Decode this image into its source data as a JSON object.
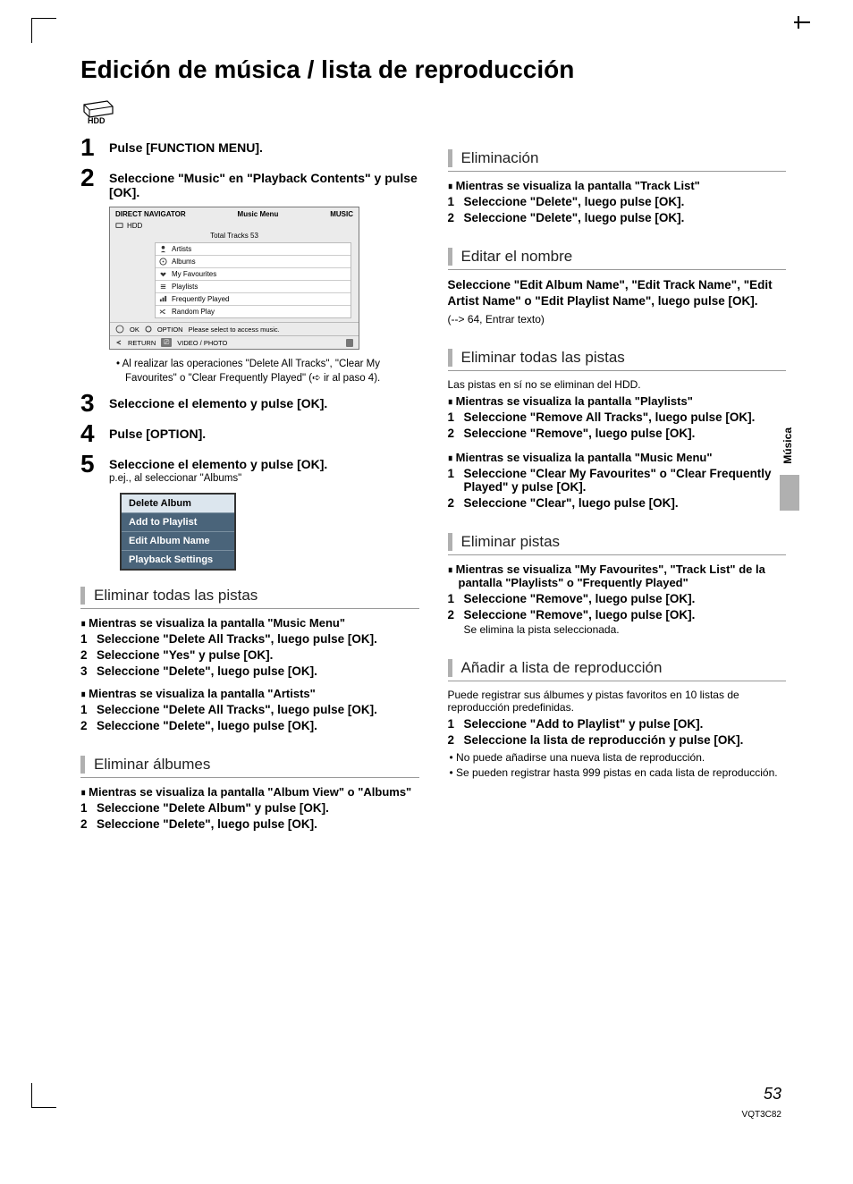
{
  "page_title": "Edición de música / lista de reproducción",
  "hdd_label": "HDD",
  "steps": {
    "s1": "Pulse [FUNCTION MENU].",
    "s2": "Seleccione \"Music\" en \"Playback Contents\" y pulse [OK].",
    "s3": "Seleccione el elemento y pulse [OK].",
    "s4": "Pulse [OPTION].",
    "s5": "Seleccione el elemento y pulse [OK].",
    "s5_sub": "p.ej., al seleccionar \"Albums\""
  },
  "ui": {
    "header_left": "DIRECT NAVIGATOR",
    "header_mid": "Music Menu",
    "header_right": "MUSIC",
    "hdd": "HDD",
    "total": "Total Tracks  53",
    "items": [
      "Artists",
      "Albums",
      "My Favourites",
      "Playlists",
      "Frequently Played",
      "Random Play"
    ],
    "foot_ok": "OK",
    "foot_option": "OPTION",
    "foot_hint": "Please select to access music.",
    "foot_return": "RETURN",
    "foot_tab": "VIDEO / PHOTO"
  },
  "step2_notes": "Al realizar las operaciones \"Delete All Tracks\", \"Clear My Favourites\" o \"Clear Frequently Played\" (➪ ir al paso 4).",
  "option_menu": [
    "Delete Album",
    "Add to Playlist",
    "Edit Album Name",
    "Playback Settings"
  ],
  "left": {
    "sec1": {
      "title": "Eliminar todas las pistas",
      "sq1": "Mientras se visualiza la pantalla \"Music Menu\"",
      "l1": "Seleccione \"Delete All Tracks\", luego pulse [OK].",
      "l2": "Seleccione \"Yes\" y pulse [OK].",
      "l3": "Seleccione \"Delete\", luego pulse [OK].",
      "sq2": "Mientras se visualiza la pantalla \"Artists\"",
      "l4": "Seleccione \"Delete All Tracks\", luego pulse [OK].",
      "l5": "Seleccione \"Delete\", luego pulse [OK]."
    },
    "sec2": {
      "title": "Eliminar álbumes",
      "sq1": "Mientras se visualiza la pantalla \"Album View\" o \"Albums\"",
      "l1": "Seleccione \"Delete Album\" y pulse [OK].",
      "l2": "Seleccione \"Delete\", luego pulse [OK]."
    }
  },
  "right": {
    "sec1": {
      "title": "Eliminación",
      "sq1": "Mientras se visualiza la pantalla \"Track List\"",
      "l1": "Seleccione \"Delete\", luego pulse [OK].",
      "l2": "Seleccione \"Delete\", luego pulse [OK]."
    },
    "sec2": {
      "title": "Editar el nombre",
      "bold": "Seleccione \"Edit Album Name\", \"Edit Track Name\", \"Edit Artist Name\" o \"Edit Playlist Name\", luego pulse [OK].",
      "ref": "(--> 64, Entrar texto)"
    },
    "sec3": {
      "title": "Eliminar todas las pistas",
      "intro": "Las pistas en sí no se eliminan del HDD.",
      "sq1": "Mientras se visualiza la pantalla \"Playlists\"",
      "l1": "Seleccione \"Remove All Tracks\", luego pulse [OK].",
      "l2": "Seleccione \"Remove\", luego pulse [OK].",
      "sq2": "Mientras se visualiza la pantalla \"Music Menu\"",
      "l3": "Seleccione \"Clear My Favourites\" o \"Clear Frequently Played\" y pulse [OK].",
      "l4": "Seleccione \"Clear\", luego pulse [OK]."
    },
    "sec4": {
      "title": "Eliminar pistas",
      "sq1": "Mientras se visualiza \"My Favourites\", \"Track List\" de la pantalla \"Playlists\" o \"Frequently Played\"",
      "l1": "Seleccione \"Remove\", luego pulse [OK].",
      "l2": "Seleccione \"Remove\", luego pulse [OK].",
      "l2_sub": "Se elimina la pista seleccionada."
    },
    "sec5": {
      "title": "Añadir a lista de reproducción",
      "intro": "Puede registrar sus álbumes y pistas favoritos en 10 listas de reproducción predefinidas.",
      "l1": "Seleccione \"Add to Playlist\" y pulse [OK].",
      "l2": "Seleccione la lista de reproducción y pulse [OK].",
      "b1": "No puede añadirse una nueva lista de reproducción.",
      "b2": "Se pueden registrar hasta 999 pistas en cada lista de reproducción."
    }
  },
  "side_tab": "Música",
  "page_number": "53",
  "doc_code": "VQT3C82"
}
